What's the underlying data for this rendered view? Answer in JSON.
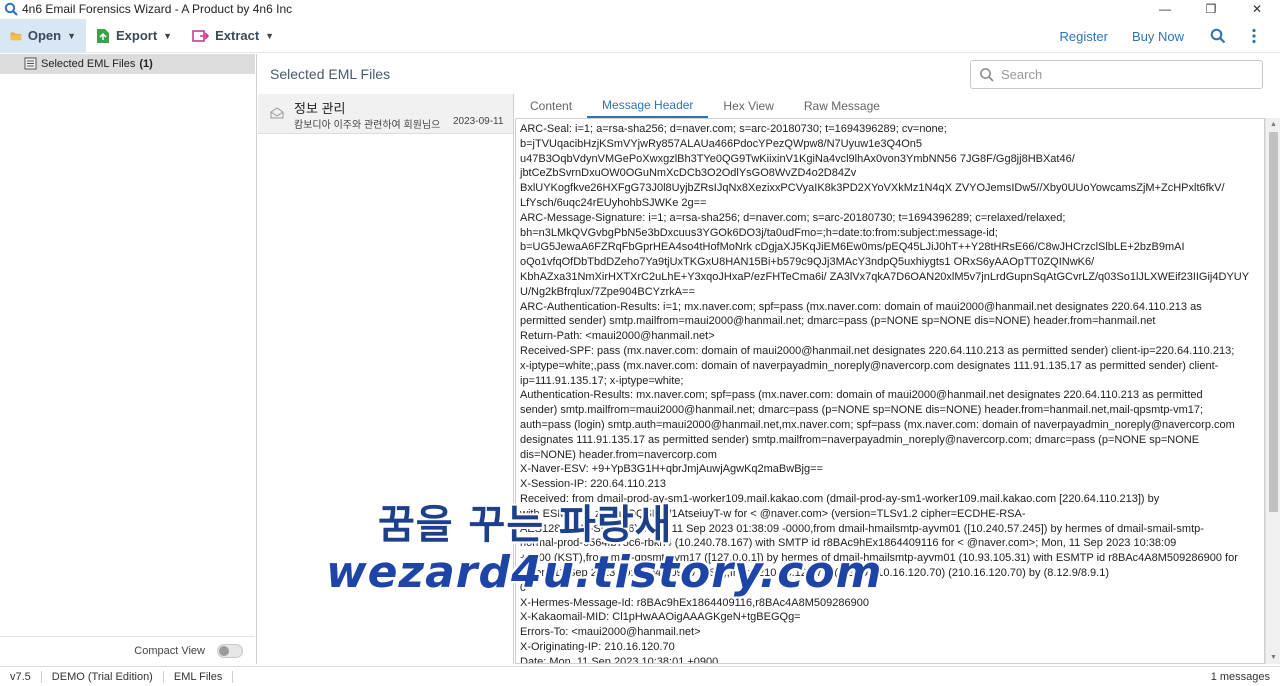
{
  "window": {
    "title": "4n6 Email Forensics Wizard - A Product by 4n6 Inc",
    "minimize": "—",
    "restore": "❐",
    "close": "✕"
  },
  "toolbar": {
    "open_label": "Open",
    "export_label": "Export",
    "extract_label": "Extract",
    "register_label": "Register",
    "buy_label": "Buy Now"
  },
  "sidebar": {
    "item_label": "Selected EML Files",
    "item_count": "(1)",
    "compact_label": "Compact View"
  },
  "main": {
    "title": "Selected EML Files",
    "search_placeholder": "Search"
  },
  "messages": [
    {
      "subject": "정보 관리",
      "from": "캄보디아 이주와 관련하여 회원님으",
      "date": "2023-09-11"
    }
  ],
  "tabs": [
    "Content",
    "Message Header",
    "Hex View",
    "Raw Message"
  ],
  "active_tab": "Message Header",
  "header_lines": [
    "ARC-Seal: i=1; a=rsa-sha256; d=naver.com; s=arc-20180730; t=1694396289;      cv=none;",
    "b=jTVUqacibHzjKSmVYjwRy857ALAUa466PdocYPezQWpw8/N7Uyuw1e3Q4On5",
    "u47B3OqbVdynVMGePoXwxgzlBh3TYe0QG9TwKiixinV1KgiNa4vcl9lhAx0von3YmbNN56    7JG8F/Gg8jj8HBXat46/",
    "jbtCeZbSvrnDxuOW0OGuNmXcDCb3O2OdlYsGO8WvZD4o2D84Zv",
    "BxlUYKogfkve26HXFgG73J0l8UyjbZRsIJqNx8XezixxPCVyaIK8k3PD2XYoVXkMz1N4qX        ZVYOJemsIDw5//Xby0UUoYowcamsZjM+ZcHPxlt6fkV/",
    "LfYsch/6uqc24rEUyhohbSJWKe        2g==",
    "ARC-Message-Signature: i=1; a=rsa-sha256; d=naver.com; s=arc-20180730;      t=1694396289; c=relaxed/relaxed;",
    "            bh=n3LMkQVGvbgPbN5e3bDxcuus3YGOk6DO3j/ta0udFmo=;h=date:to:from:subject:message-id;",
    "b=UG5JewaA6FZRqFbGprHEA4so4tHofMoNrk           cDgjaXJ5KqJiEM6Ew0ms/pEQ45LJiJ0hT++Y28tHRsE66/C8wJHCrzclSlbLE+2bzB9mAI",
    "oQo1vfqOfDbTbdDZeho7Ya9tjUxTKGxU8HAN15Bi+b579c9QJj3MAcY3ndpQ5uxhiygts1     ORxS6yAAOpTT0ZQINwK6/",
    "KbhAZxa31NmXirHXTXrC2uLhE+Y3xqoJHxaP/ezFHTeCma6i/     ZA3lVx7qkA7D6OAN20xlM5v7jnLrdGupnSqAtGCvrLZ/q03So1lJLXWEif23IIGij4DYUY",
    "            U/Ng2kBfrqlux/7Zpe904BCYzrkA==",
    "ARC-Authentication-Results: i=1; mx.naver.com;    spf=pass (mx.naver.com: domain of maui2000@hanmail.net designates 220.64.110.213 as",
    "permitted sender) smtp.mailfrom=maui2000@hanmail.net;  dmarc=pass (p=NONE sp=NONE dis=NONE) header.from=hanmail.net",
    "Return-Path: <maui2000@hanmail.net>",
    "Received-SPF: pass (mx.naver.com: domain of maui2000@hanmail.net designates 220.64.110.213 as permitted sender)  client-ip=220.64.110.213;",
    "x-iptype=white;,pass (mx.naver.com: domain of naverpayadmin_noreply@navercorp.com designates 111.91.135.17 as permitted sender)  client-",
    "ip=111.91.135.17; x-iptype=white;",
    "Authentication-Results: mx.naver.com;   spf=pass (mx.naver.com: domain of maui2000@hanmail.net designates 220.64.110.213 as permitted",
    "sender) smtp.mailfrom=maui2000@hanmail.net;  dmarc=pass (p=NONE sp=NONE dis=NONE) header.from=hanmail.net,mail-qpsmtp-vm17;",
    "auth=pass (login) smtp.auth=maui2000@hanmail.net,mx.naver.com; spf=pass (mx.naver.com: domain of naverpayadmin_noreply@navercorp.com",
    "designates 111.91.135.17 as permitted sender) smtp.mailfrom=naverpayadmin_noreply@navercorp.com;  dmarc=pass (p=NONE sp=NONE",
    "dis=NONE) header.from=navercorp.com",
    "X-Naver-ESV: +9+YpB3G1H+qbrJmjAuwjAgwKq2maBwBjg==",
    "X-Session-IP: 220.64.110.213",
    "Received: from dmail-prod-ay-sm1-worker109.mail.kakao.com (dmail-prod-ay-sm1-worker109.mail.kakao.com [220.64.110.213])  by",
    "          with ESMTP id zzy-hqOQSMW1AtseiuyT-w  for <            @naver.com>  (version=TLSv1.2 cipher=ECDHE-RSA-",
    "AES128-GCM-SHA256);  Mon, 11 Sep 2023 01:38:09 -0000,from dmail-hmailsmtp-ayvm01 ([10.240.57.245]) by hermes of dmail-smail-smtp-",
    "normal-prod-6564fb75c6-rbkn4 (10.240.78.167) with SMTP id r8BAc9hEx1864409116 for <            @naver.com>; Mon, 11 Sep 2023 10:38:09",
    "+0900 (KST),from mail-qpsmtp-vm17 ([127.0.0.1]) by hermes of dmail-hmailsmtp-ayvm01 (10.93.105.31) with ESMTP id r8BAc4A8M509286900 for",
    "                 ; Mon, 11 Sep 2023 10:38:04 +0900 (KST),from [210.16.120.70] (HELO 210.16.120.70) (210.16.120.70) by  (8.12.9/8.9.1)",
    "                                          0",
    "X-Hermes-Message-Id: r8BAc9hEx1864409116,r8BAc4A8M509286900",
    "X-Kakaomail-MID: Cl1pHwAAOigAAAGKgeN+tgBEGQg=",
    "Errors-To: <maui2000@hanmail.net>",
    "X-Originating-IP: 210.16.120.70",
    "Date: Mon, 11 Sep 2023 10:38:01 +0900"
  ],
  "watermark": {
    "line1": "꿈을 꾸는 파랑새",
    "line2": "wezard4u.tistory.com"
  },
  "status": {
    "version": "v7.5",
    "edition": "DEMO (Trial Edition)",
    "mode": "EML Files",
    "count": "1 messages"
  }
}
